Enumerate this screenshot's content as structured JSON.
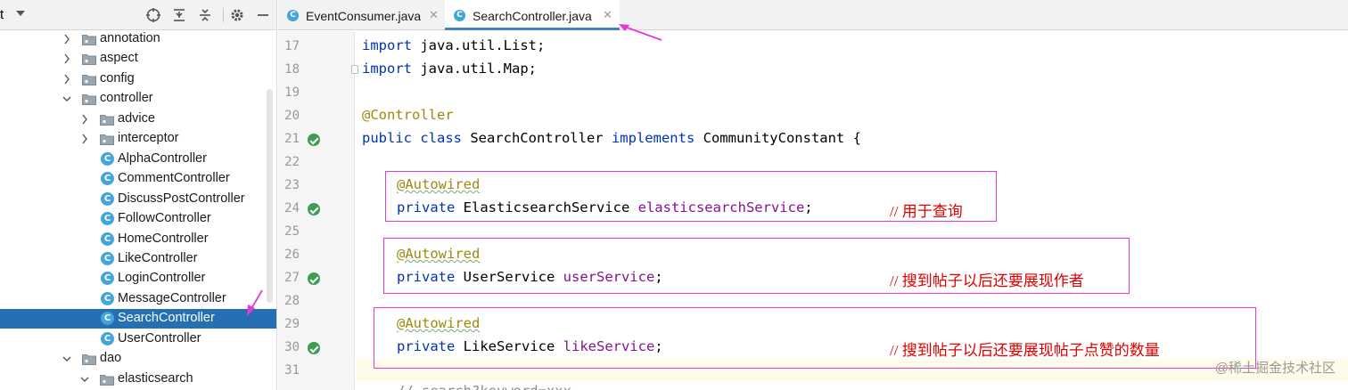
{
  "sidebar": {
    "header_title": "t",
    "tree": [
      {
        "label": "annotation",
        "type": "folder",
        "expanded": false
      },
      {
        "label": "aspect",
        "type": "folder",
        "expanded": false
      },
      {
        "label": "config",
        "type": "folder",
        "expanded": false
      },
      {
        "label": "controller",
        "type": "folder",
        "expanded": true
      },
      {
        "label": "advice",
        "type": "folder",
        "expanded": false
      },
      {
        "label": "interceptor",
        "type": "folder",
        "expanded": false
      },
      {
        "label": "AlphaController",
        "type": "class"
      },
      {
        "label": "CommentController",
        "type": "class"
      },
      {
        "label": "DiscussPostController",
        "type": "class"
      },
      {
        "label": "FollowController",
        "type": "class"
      },
      {
        "label": "HomeController",
        "type": "class"
      },
      {
        "label": "LikeController",
        "type": "class"
      },
      {
        "label": "LoginController",
        "type": "class"
      },
      {
        "label": "MessageController",
        "type": "class"
      },
      {
        "label": "SearchController",
        "type": "class",
        "selected": true
      },
      {
        "label": "UserController",
        "type": "class"
      },
      {
        "label": "dao",
        "type": "folder",
        "expanded": true
      },
      {
        "label": "elasticsearch",
        "type": "folder",
        "expanded": true
      }
    ]
  },
  "tabs": [
    {
      "label": "EventConsumer.java",
      "icon": "C",
      "active": false
    },
    {
      "label": "SearchController.java",
      "icon": "C",
      "active": true
    }
  ],
  "editor": {
    "line_numbers": [
      "17",
      "18",
      "19",
      "20",
      "21",
      "22",
      "23",
      "24",
      "25",
      "26",
      "27",
      "28",
      "29",
      "30",
      "31"
    ],
    "lines": {
      "l17_kw": "import",
      "l17_rest": " java.util.List;",
      "l18_kw": "import",
      "l18_rest": " java.util.Map;",
      "l20_ann": "@Controller",
      "l21_kw": "public class",
      "l21_name": " SearchController ",
      "l21_impl": "implements",
      "l21_rest": " CommunityConstant {",
      "l23_ann": "@Autowired",
      "l24_kw": "private",
      "l24_type": " ElasticsearchService ",
      "l24_field": "elasticsearchService",
      "l24_semi": ";",
      "l24_comment": "// 用于查询",
      "l26_ann": "@Autowired",
      "l27_kw": "private",
      "l27_type": " UserService ",
      "l27_field": "userService",
      "l27_semi": ";",
      "l27_comment": "// 搜到帖子以后还要展现作者",
      "l29_ann": "@Autowired",
      "l30_kw": "private",
      "l30_type": " LikeService ",
      "l30_field": "likeService",
      "l30_semi": ";",
      "l30_comment": "// 搜到帖子以后还要展现帖子点赞的数量",
      "l32_partial": "// search?keyword=xxx"
    }
  },
  "watermark": "@稀土掘金技术社区",
  "colors": {
    "selection": "#2470b3",
    "keyword": "#0033b3",
    "annotation": "#9e880d",
    "field": "#871094",
    "comment": "#e00000",
    "highlight_box": "#e438d9",
    "class_icon": "#43a5da"
  }
}
